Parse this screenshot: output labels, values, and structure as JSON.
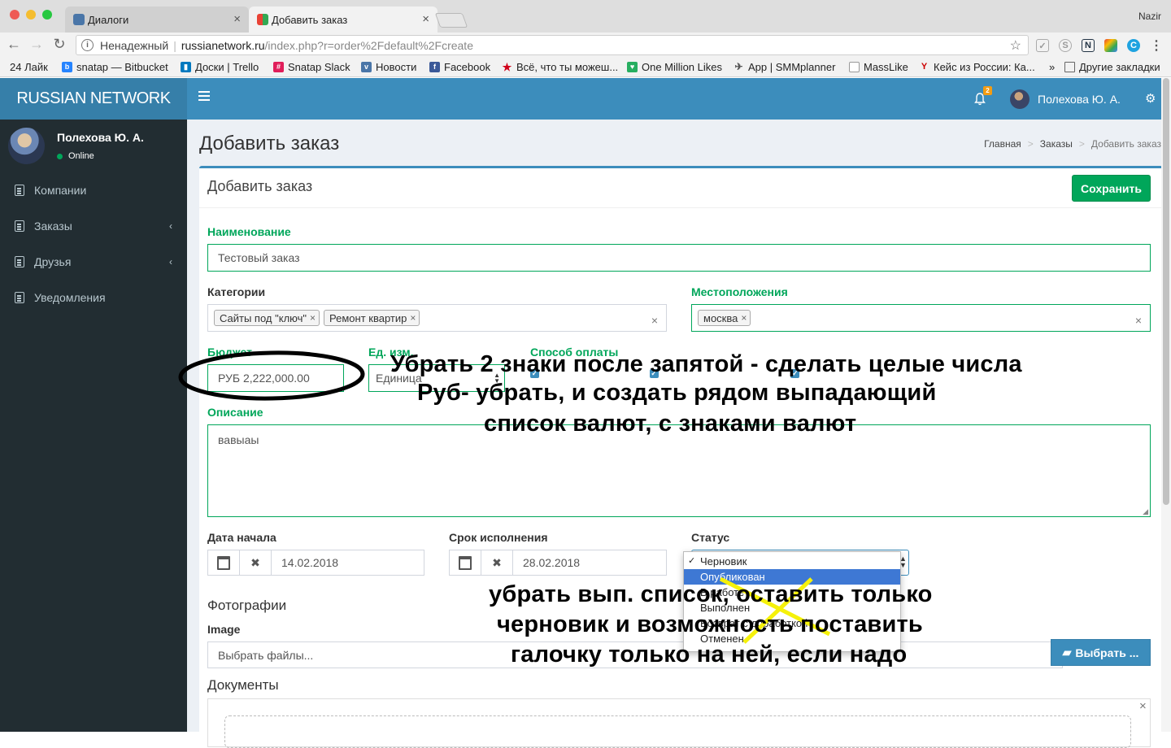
{
  "browser": {
    "tabs": [
      {
        "label": "Диалоги",
        "active": false
      },
      {
        "label": "Добавить заказ",
        "active": true
      }
    ],
    "profile": "Nazir",
    "address": {
      "security": "Ненадежный",
      "host": "russianetwork.ru",
      "path": "/index.php?r=order%2Fdefault%2Fcreate"
    },
    "bookmarks": [
      {
        "label": "24 Лайк",
        "icon": "24-icon"
      },
      {
        "label": "snatap — Bitbucket",
        "icon": "bitbucket-icon"
      },
      {
        "label": "Доски | Trello",
        "icon": "trello-icon"
      },
      {
        "label": "Snatap Slack",
        "icon": "slack-icon"
      },
      {
        "label": "Новости",
        "icon": "vk-icon"
      },
      {
        "label": "Facebook",
        "icon": "facebook-icon"
      },
      {
        "label": "Всё, что ты можеш...",
        "icon": "star-icon"
      },
      {
        "label": "One Million Likes",
        "icon": "heart-icon"
      },
      {
        "label": "App | SMMplanner",
        "icon": "plane-icon"
      },
      {
        "label": "MassLike",
        "icon": "page-icon"
      },
      {
        "label": "Кейс из России: Ка...",
        "icon": "yc-icon"
      },
      {
        "label": "Другие закладки",
        "icon": "folder-icon"
      }
    ],
    "bookmarks_overflow": "»"
  },
  "app": {
    "brand": "RUSSIAN NETWORK",
    "notifications_count": "2",
    "user_name": "Полехова Ю. А.",
    "user_status": "Online",
    "menu": [
      {
        "label": "Компании",
        "has_children": false
      },
      {
        "label": "Заказы",
        "has_children": true
      },
      {
        "label": "Друзья",
        "has_children": true
      },
      {
        "label": "Уведомления",
        "has_children": false
      }
    ]
  },
  "page": {
    "title": "Добавить заказ",
    "breadcrumb": [
      "Главная",
      "Заказы",
      "Добавить заказ"
    ],
    "box_title": "Добавить заказ",
    "save_label": "Сохранить"
  },
  "form": {
    "name_label": "Наименование",
    "name_value": "Тестовый заказ",
    "categories_label": "Категории",
    "categories": [
      "Сайты под \"ключ\"",
      "Ремонт квартир"
    ],
    "locations_label": "Местоположения",
    "locations": [
      "москва"
    ],
    "budget_label": "Бюджет",
    "budget_value": "РУБ 2,222,000.00",
    "unit_label": "Ед. изм.",
    "unit_value": "Единица",
    "payment_label": "Способ оплаты",
    "description_label": "Описание",
    "description_value": "вавыаы",
    "start_label": "Дата начала",
    "start_value": "14.02.2018",
    "due_label": "Срок исполнения",
    "due_value": "28.02.2018",
    "status_label": "Статус",
    "status_options": [
      "Черновик",
      "Опубликован",
      "В работе",
      "Выполнен",
      "Возврат с доработкой",
      "Отменен"
    ],
    "status_checked": "Черновик",
    "status_highlighted": "Опубликован",
    "photos_label": "Фотографии",
    "image_label": "Image",
    "file_placeholder": "Выбрать файлы...",
    "choose_label": "Выбрать ...",
    "documents_label": "Документы"
  },
  "annotations": {
    "budget_note": [
      "Убрать 2 знаки после запятой - сделать целые числа",
      "Руб- убрать, и создать рядом выпадающий",
      "список валют, с знаками  валют"
    ],
    "status_note": [
      "убрать вып. список, оставить только",
      "черновик и возможность поставить",
      "галочку только на ней, если надо"
    ]
  },
  "colors": {
    "topbar": "#3c8dbc",
    "brand_bg": "#367fa9",
    "sidebar": "#222d32",
    "success": "#00a65a",
    "annotation_ellipse": "#000000",
    "annotation_cross": "#f5f10a"
  }
}
